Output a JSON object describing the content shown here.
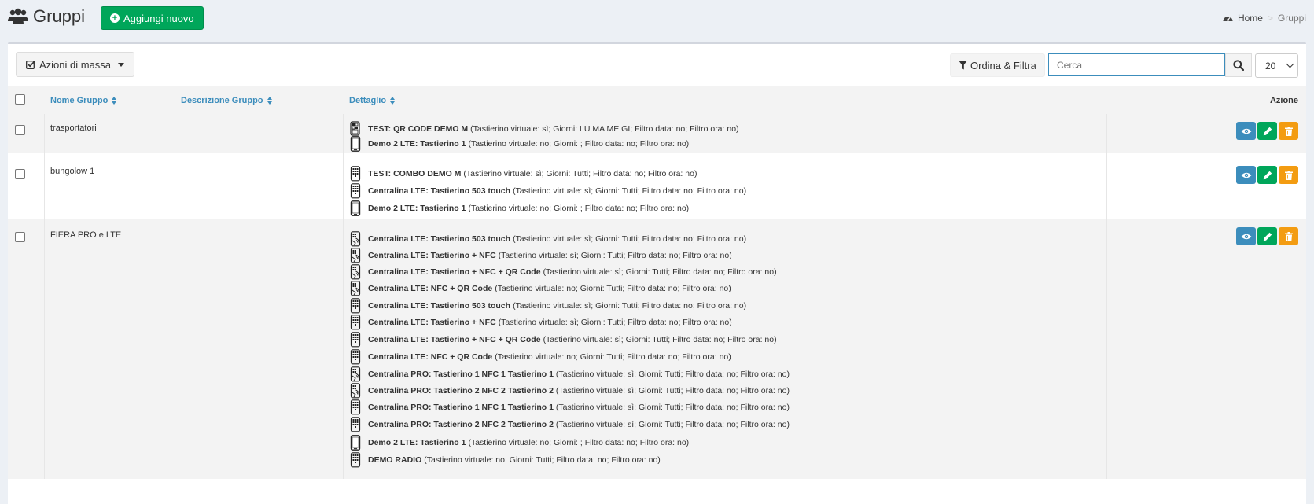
{
  "header": {
    "title": "Gruppi",
    "add_button": "Aggiungi nuovo",
    "breadcrumb": {
      "home": "Home",
      "current": "Gruppi"
    }
  },
  "toolbar": {
    "mass_actions": "Azioni di massa",
    "filter_button": "Ordina & Filtra",
    "search_placeholder": "Cerca",
    "per_page": "20"
  },
  "table": {
    "columns": {
      "name": "Nome Gruppo",
      "description": "Descrizione Gruppo",
      "detail": "Dettaglio",
      "action": "Azione"
    },
    "rows": [
      {
        "name": "trasportatori",
        "description": "",
        "details": [
          {
            "icon": "qr-keypad-icon",
            "title": "TEST: QR CODE DEMO M",
            "info": "(Tastierino virtuale: sì; Giorni: LU MA ME GI; Filtro data: no; Filtro ora: no)"
          },
          {
            "icon": "phone-icon",
            "title": "Demo 2 LTE: Tastierino 1",
            "info": "(Tastierino virtuale: no; Giorni: ; Filtro data: no; Filtro ora: no)"
          }
        ]
      },
      {
        "name": "bungolow 1",
        "description": "",
        "details": [
          {
            "icon": "keypad-icon",
            "title": "TEST: COMBO DEMO M",
            "info": "(Tastierino virtuale: sì; Giorni: Tutti; Filtro data: no; Filtro ora: no)"
          },
          {
            "icon": "keypad-icon",
            "title": "Centralina LTE: Tastierino 503 touch",
            "info": "(Tastierino virtuale: sì; Giorni: Tutti; Filtro data: no; Filtro ora: no)"
          },
          {
            "icon": "phone-icon",
            "title": "Demo 2 LTE: Tastierino 1",
            "info": "(Tastierino virtuale: no; Giorni: ; Filtro data: no; Filtro ora: no)"
          }
        ]
      },
      {
        "name": "FIERA PRO e LTE",
        "description": "",
        "details": [
          {
            "icon": "keypad-nfc-icon",
            "title": "Centralina LTE: Tastierino 503 touch",
            "info": "(Tastierino virtuale: sì; Giorni: Tutti; Filtro data: no; Filtro ora: no)"
          },
          {
            "icon": "keypad-nfc-icon",
            "title": "Centralina LTE: Tastierino + NFC",
            "info": "(Tastierino virtuale: sì; Giorni: Tutti; Filtro data: no; Filtro ora: no)"
          },
          {
            "icon": "keypad-nfc-icon",
            "title": "Centralina LTE: Tastierino + NFC + QR Code",
            "info": "(Tastierino virtuale: sì; Giorni: Tutti; Filtro data: no; Filtro ora: no)"
          },
          {
            "icon": "keypad-nfc-icon",
            "title": "Centralina LTE: NFC + QR Code",
            "info": "(Tastierino virtuale: no; Giorni: Tutti; Filtro data: no; Filtro ora: no)"
          },
          {
            "icon": "keypad-icon",
            "title": "Centralina LTE: Tastierino 503 touch",
            "info": "(Tastierino virtuale: sì; Giorni: Tutti; Filtro data: no; Filtro ora: no)"
          },
          {
            "icon": "keypad-icon",
            "title": "Centralina LTE: Tastierino + NFC",
            "info": "(Tastierino virtuale: sì; Giorni: Tutti; Filtro data: no; Filtro ora: no)"
          },
          {
            "icon": "keypad-icon",
            "title": "Centralina LTE: Tastierino + NFC + QR Code",
            "info": "(Tastierino virtuale: sì; Giorni: Tutti; Filtro data: no; Filtro ora: no)"
          },
          {
            "icon": "keypad-icon",
            "title": "Centralina LTE: NFC + QR Code",
            "info": "(Tastierino virtuale: no; Giorni: Tutti; Filtro data: no; Filtro ora: no)"
          },
          {
            "icon": "keypad-nfc-icon",
            "title": "Centralina PRO: Tastierino 1 NFC 1 Tastierino 1",
            "info": "(Tastierino virtuale: sì; Giorni: Tutti; Filtro data: no; Filtro ora: no)"
          },
          {
            "icon": "keypad-nfc-icon",
            "title": "Centralina PRO: Tastierino 2 NFC 2 Tastierino 2",
            "info": "(Tastierino virtuale: sì; Giorni: Tutti; Filtro data: no; Filtro ora: no)"
          },
          {
            "icon": "keypad-icon",
            "title": "Centralina PRO: Tastierino 1 NFC 1 Tastierino 1",
            "info": "(Tastierino virtuale: sì; Giorni: Tutti; Filtro data: no; Filtro ora: no)"
          },
          {
            "icon": "keypad-icon",
            "title": "Centralina PRO: Tastierino 2 NFC 2 Tastierino 2",
            "info": "(Tastierino virtuale: sì; Giorni: Tutti; Filtro data: no; Filtro ora: no)"
          },
          {
            "icon": "phone-icon",
            "title": "Demo 2 LTE: Tastierino 1",
            "info": "(Tastierino virtuale: no; Giorni: ; Filtro data: no; Filtro ora: no)"
          },
          {
            "icon": "keypad-icon",
            "title": "DEMO RADIO",
            "info": "(Tastierino virtuale: no; Giorni: Tutti; Filtro data: no; Filtro ora: no)"
          }
        ]
      }
    ]
  },
  "colors": {
    "primary": "#3c8dbc",
    "success": "#00a65a",
    "warning": "#f39c12",
    "background": "#ecf0f5"
  }
}
